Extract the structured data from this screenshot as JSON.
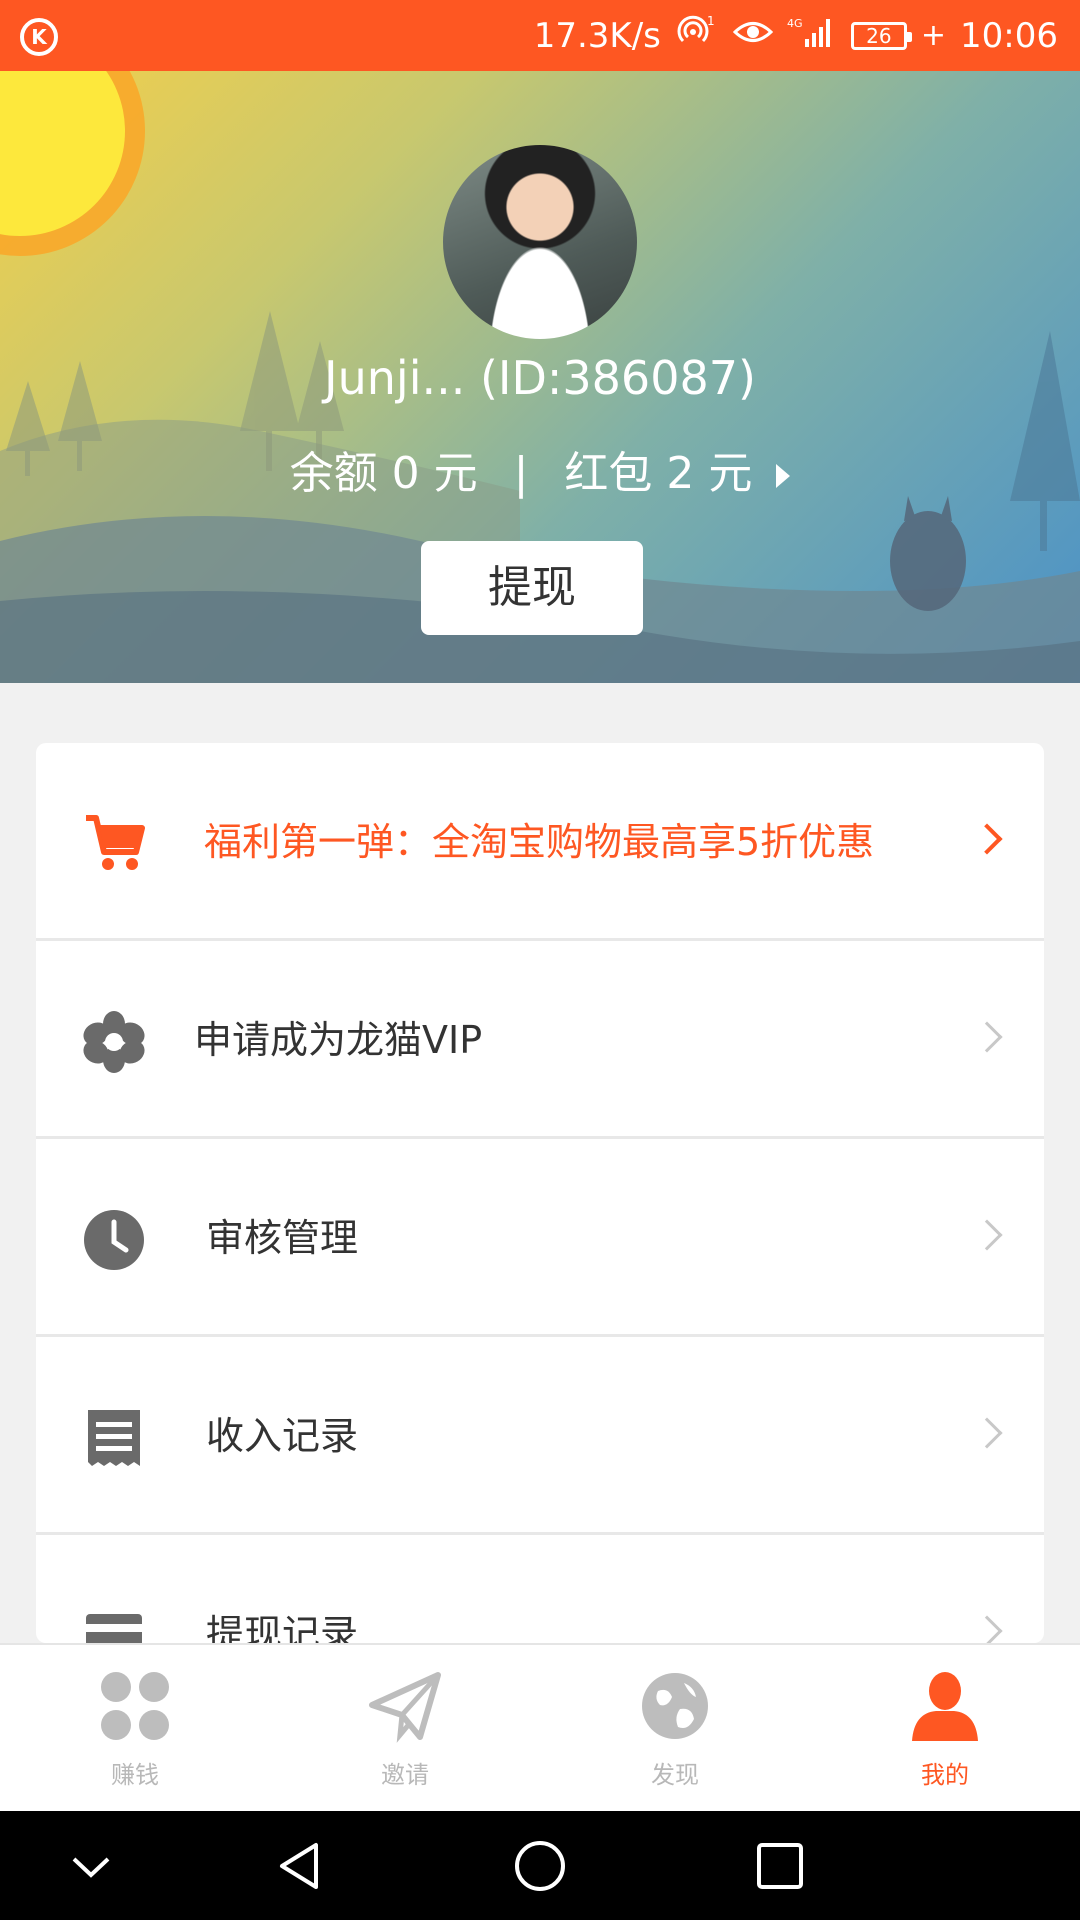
{
  "status_bar": {
    "network_speed": "17.3K/s",
    "signal_label": "4G",
    "hotspot_badge": "1",
    "battery": "26",
    "time": "10:06"
  },
  "profile": {
    "username": "Junji... (ID:386087)",
    "balance_label": "余额 0 元",
    "separator": "|",
    "red_packet_label": "红包 2 元",
    "withdraw_button": "提现"
  },
  "menu": {
    "items": [
      {
        "label": "福利第一弹：全淘宝购物最高享5折优惠",
        "icon": "cart-icon"
      },
      {
        "label": "申请成为龙猫VIP",
        "icon": "flower-icon"
      },
      {
        "label": "审核管理",
        "icon": "clock-icon"
      },
      {
        "label": "收入记录",
        "icon": "receipt-icon"
      },
      {
        "label": "提现记录",
        "icon": "card-icon"
      }
    ]
  },
  "bottom_nav": {
    "items": [
      {
        "label": "赚钱",
        "icon": "grid-dots-icon"
      },
      {
        "label": "邀请",
        "icon": "paper-plane-icon"
      },
      {
        "label": "发现",
        "icon": "globe-icon"
      },
      {
        "label": "我的",
        "icon": "person-icon"
      }
    ],
    "active_index": 3
  },
  "colors": {
    "accent": "#fe5722",
    "inactive": "#b8b8b8",
    "text": "#333333"
  }
}
